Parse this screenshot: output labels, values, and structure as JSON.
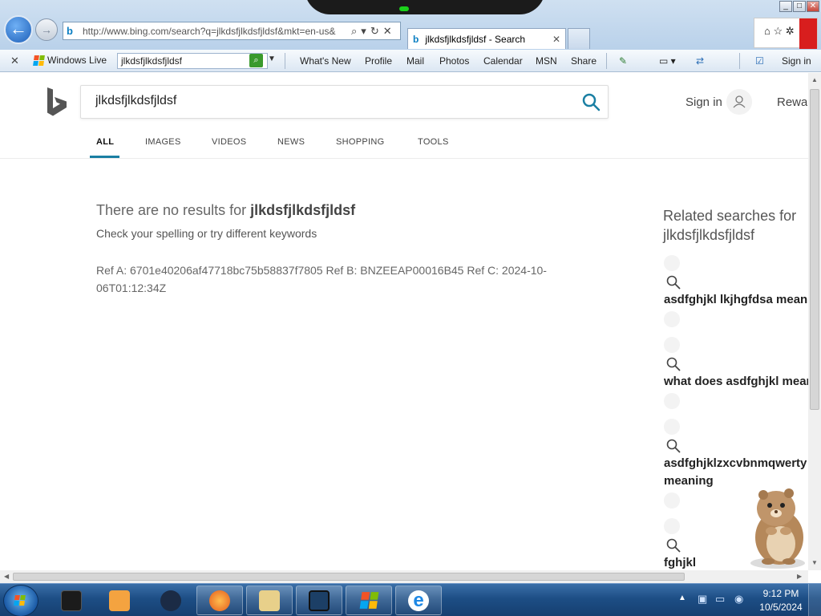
{
  "browser": {
    "address_url": "http://www.bing.com/search?q=jlkdsfjlkdsfjldsf&mkt=en-us&",
    "tab_title": "jlkdsfjlkdsfjldsf - Search",
    "toolbar": {
      "windows_live_label": "Windows Live",
      "search_value": "jlkdsfjlkdsfjldsf",
      "links": [
        "What's New",
        "Profile",
        "Mail",
        "Photos",
        "Calendar",
        "MSN",
        "Share"
      ],
      "sign_in": "Sign in"
    }
  },
  "bing": {
    "query": "jlkdsfjlkdsfjldsf",
    "sign_in": "Sign in",
    "rewards": "Rewards",
    "tabs": [
      "ALL",
      "IMAGES",
      "VIDEOS",
      "NEWS",
      "SHOPPING",
      "TOOLS"
    ],
    "active_tab": "ALL",
    "no_results_prefix": "There are no results for ",
    "no_results_query": "jlkdsfjlkdsfjldsf",
    "spelling_hint": "Check your spelling or try different keywords",
    "ref_text": "Ref A: 6701e40206af47718bc75b58837f7805 Ref B: BNZEEAP00016B45 Ref C: 2024-10-06T01:12:34Z",
    "related": {
      "title_line1": "Related searches for",
      "title_line2": "jlkdsfjlkdsfjldsf",
      "items": [
        "asdfghjkl lkjhgfdsa meaning",
        "what does asdfghjkl mean",
        "asdfghjklzxcvbnmqwerty",
        "meaning",
        "fghjkl"
      ]
    },
    "accent_color": "#1a7fa3"
  },
  "taskbar": {
    "time": "9:12 PM",
    "date": "10/5/2024"
  }
}
